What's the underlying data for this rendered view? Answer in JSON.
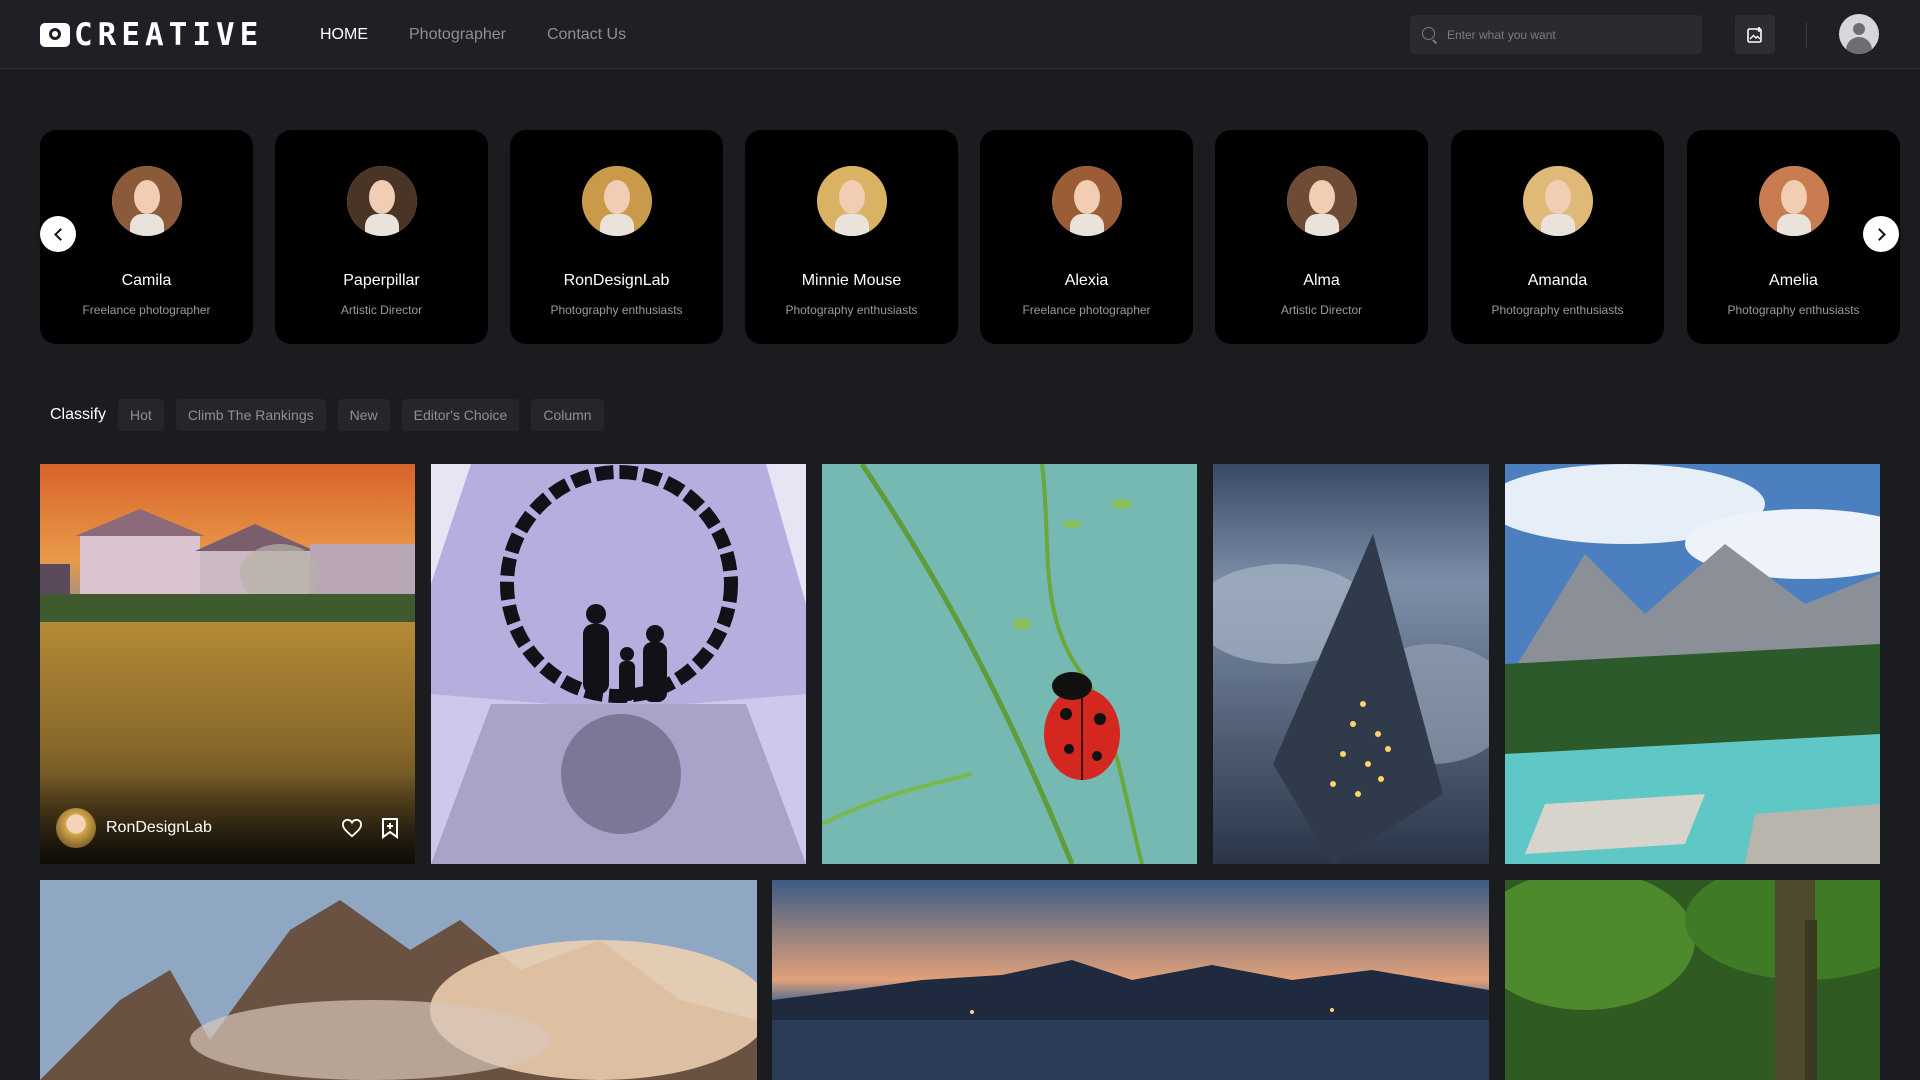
{
  "header": {
    "logo_text": "CREATIVE",
    "nav": [
      "HOME",
      "Photographer",
      "Contact Us"
    ],
    "search_placeholder": "Enter what you want"
  },
  "photographers": [
    {
      "name": "Camila",
      "role": "Freelance photographer",
      "hair": "#8a5a3a"
    },
    {
      "name": "Paperpillar",
      "role": "Artistic Director",
      "hair": "#4a3426"
    },
    {
      "name": "RonDesignLab",
      "role": "Photography enthusiasts",
      "hair": "#c89a4a"
    },
    {
      "name": "Minnie Mouse",
      "role": "Photography enthusiasts",
      "hair": "#d9b264"
    },
    {
      "name": "Alexia",
      "role": "Freelance photographer",
      "hair": "#9a5d36"
    },
    {
      "name": "Alma",
      "role": "Artistic Director",
      "hair": "#6e4b34"
    },
    {
      "name": "Amanda",
      "role": "Photography enthusiasts",
      "hair": "#e0b877"
    },
    {
      "name": "Amelia",
      "role": "Photography enthusiasts",
      "hair": "#c97c4f"
    }
  ],
  "classify": {
    "label": "Classify",
    "chips": [
      "Hot",
      "Climb The Rankings",
      "New",
      "Editor's Choice",
      "Column"
    ]
  },
  "gallery": {
    "featured_author": "RonDesignLab",
    "photos": [
      {
        "id": "house-sunset",
        "desc": "village house over golden field"
      },
      {
        "id": "silhouette-ring",
        "desc": "children silhouette through ring"
      },
      {
        "id": "ladybug",
        "desc": "ladybug on green stem"
      },
      {
        "id": "cloud-town",
        "desc": "town in clouds at night"
      },
      {
        "id": "mountain-lake",
        "desc": "mountain and turquoise water"
      },
      {
        "id": "peaks-fog",
        "desc": "rocky peaks in fog"
      },
      {
        "id": "lake-dusk",
        "desc": "lake at dusk"
      },
      {
        "id": "forest",
        "desc": "green forest trees"
      }
    ]
  },
  "colors": {
    "background": "#1b1c20",
    "header": "#1f2025",
    "card": "#000000",
    "chip": "#25262b",
    "muted_text": "#8e8f96"
  }
}
